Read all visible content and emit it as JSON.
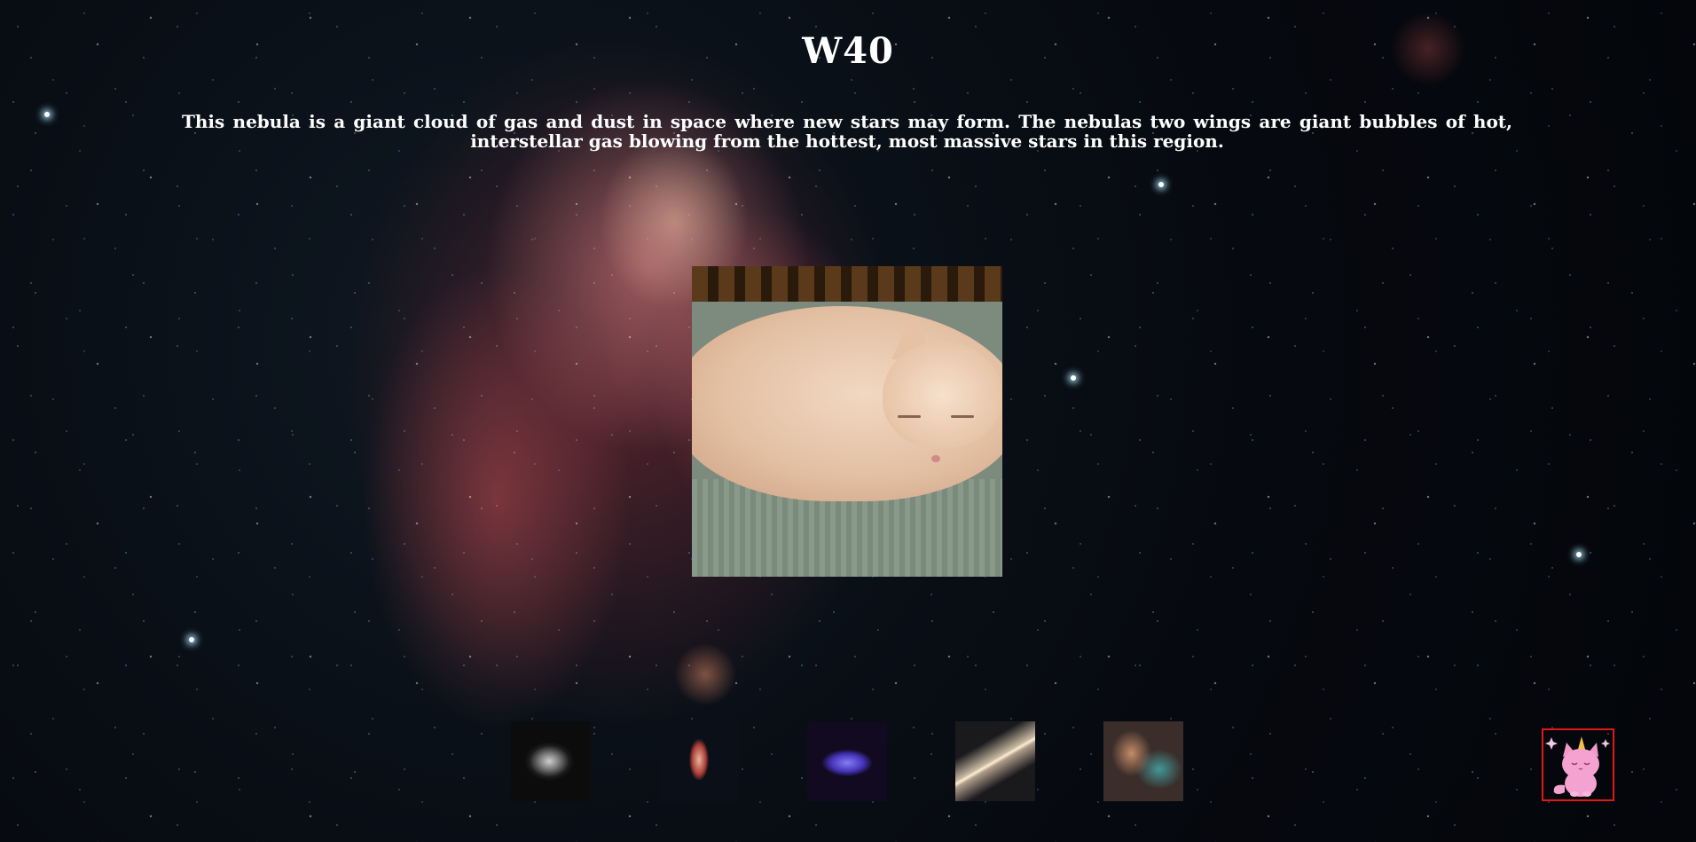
{
  "header": {
    "title": "W40"
  },
  "main": {
    "description": "This nebula is a giant cloud of gas and dust in space where new stars may form. The nebulas two wings are giant bubbles of hot, interstellar gas blowing from the hottest, most massive stars in this region.",
    "image_subject": "sleeping-cat"
  },
  "gallery": {
    "thumbnails": [
      {
        "icon": "galaxy-thumbnail"
      },
      {
        "icon": "nebula-thumbnail"
      },
      {
        "icon": "cluster-thumbnail"
      },
      {
        "icon": "spiral-galaxy-thumbnail"
      },
      {
        "icon": "nebula-cloud-thumbnail"
      }
    ]
  },
  "corner_button": {
    "icon": "unicorn-cat-icon",
    "border_color": "#e01818"
  }
}
